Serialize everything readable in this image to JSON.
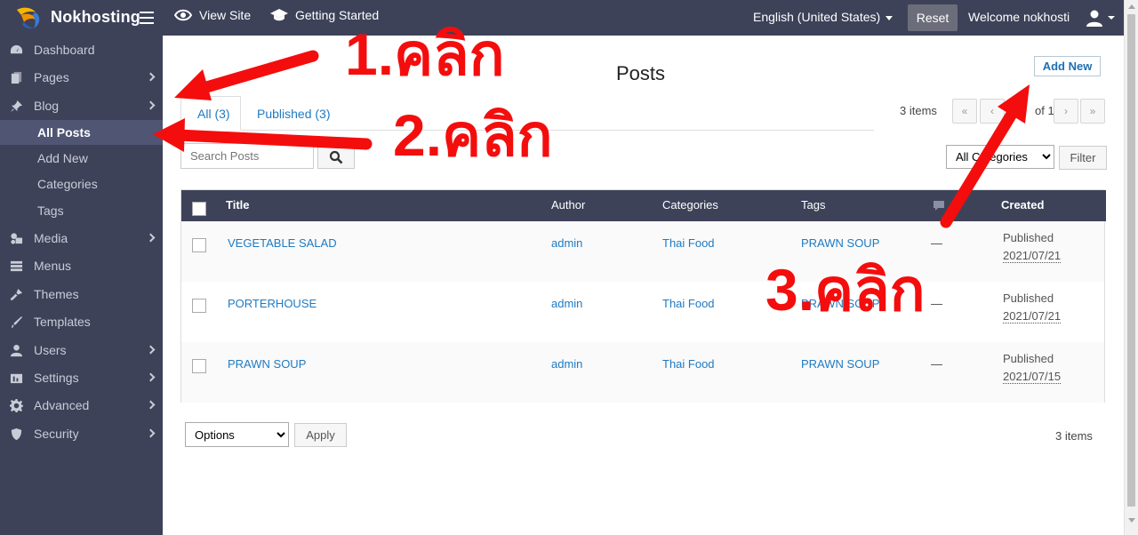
{
  "topbar": {
    "brand": "Nokhosting",
    "view_site": "View Site",
    "getting_started": "Getting Started",
    "language": "English (United States)",
    "reset": "Reset",
    "welcome": "Welcome nokhosti"
  },
  "sidebar": {
    "items": [
      {
        "label": "Dashboard",
        "icon": "dashboard-icon"
      },
      {
        "label": "Pages",
        "icon": "pages-icon"
      },
      {
        "label": "Blog",
        "icon": "pin-icon"
      },
      {
        "label": "Media",
        "icon": "media-icon"
      },
      {
        "label": "Menus",
        "icon": "menus-icon"
      },
      {
        "label": "Themes",
        "icon": "themes-icon"
      },
      {
        "label": "Templates",
        "icon": "templates-icon"
      },
      {
        "label": "Users",
        "icon": "user-icon"
      },
      {
        "label": "Settings",
        "icon": "settings-icon"
      },
      {
        "label": "Advanced",
        "icon": "gear-icon"
      },
      {
        "label": "Security",
        "icon": "shield-icon"
      }
    ],
    "blog_sub": [
      "All Posts",
      "Add New",
      "Categories",
      "Tags"
    ]
  },
  "main": {
    "title": "Posts",
    "add_new": "Add New",
    "tabs": [
      {
        "label": "All (3)"
      },
      {
        "label": "Published (3)"
      }
    ],
    "items_count": "3 items",
    "pagination": {
      "of_text": "of 1",
      "first": "«",
      "prev": "‹",
      "next": "›",
      "last": "»"
    },
    "search_placeholder": "Search Posts",
    "category_filter": "All Categories",
    "filter_button": "Filter",
    "table": {
      "headers": [
        "Title",
        "Author",
        "Categories",
        "Tags",
        "Created"
      ],
      "rows": [
        {
          "title": "VEGETABLE SALAD",
          "author": "admin",
          "category": "Thai Food",
          "tags": "PRAWN SOUP",
          "comments": "—",
          "status": "Published",
          "date": "2021/07/21"
        },
        {
          "title": "PORTERHOUSE",
          "author": "admin",
          "category": "Thai Food",
          "tags": "PRAWN SOUP",
          "comments": "—",
          "status": "Published",
          "date": "2021/07/21"
        },
        {
          "title": "PRAWN SOUP",
          "author": "admin",
          "category": "Thai Food",
          "tags": "PRAWN SOUP",
          "comments": "—",
          "status": "Published",
          "date": "2021/07/15"
        }
      ]
    },
    "bulk_options": "Options",
    "apply": "Apply"
  },
  "annotations": {
    "step1": "1.คลิก",
    "step2": "2.คลิก",
    "step3": "3.คลิก",
    "color": "#f40d0d"
  }
}
